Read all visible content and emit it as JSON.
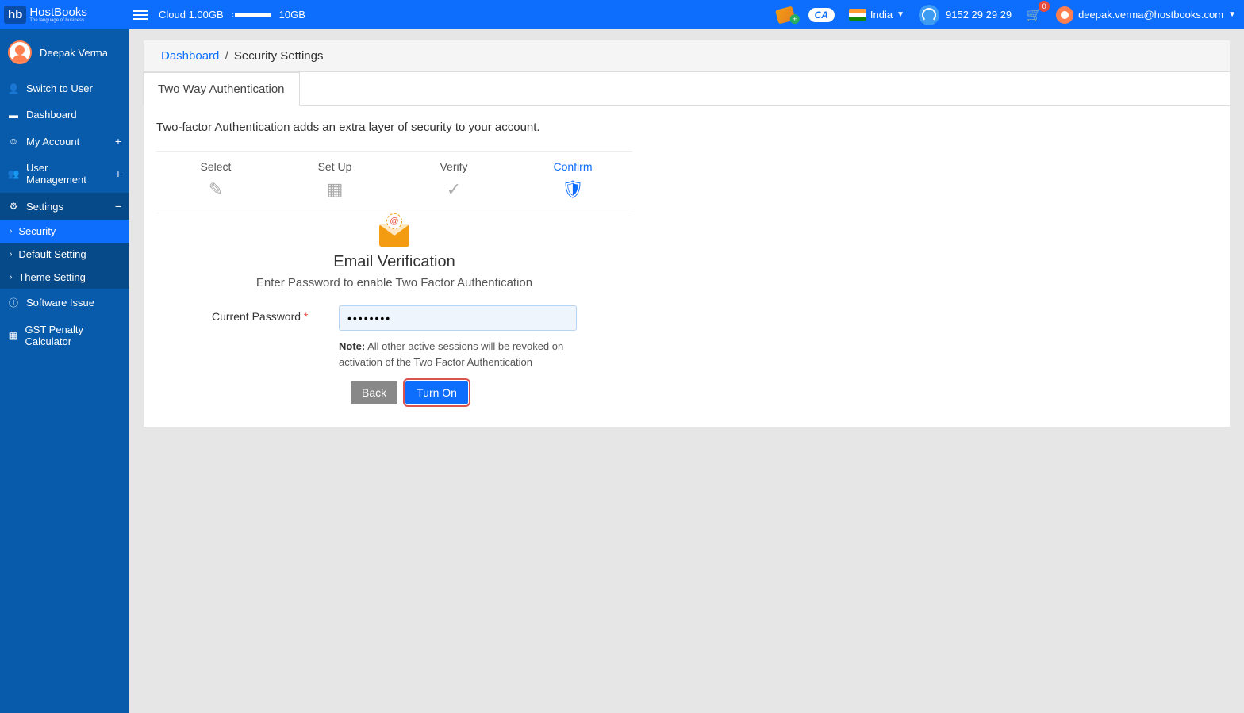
{
  "header": {
    "logo_hb": "hb",
    "logo_main": "HostBooks",
    "logo_tagline": "The language of business",
    "cloud_used": "Cloud 1.00GB",
    "cloud_total": "10GB",
    "ca_badge": "CA",
    "country": "India",
    "phone": "9152 29 29 29",
    "cart_count": "0",
    "user_email": "deepak.verma@hostbooks.com"
  },
  "sidebar": {
    "user_name": "Deepak Verma",
    "items": {
      "switch_user": "Switch to User",
      "dashboard": "Dashboard",
      "my_account": "My Account",
      "user_mgmt": "User Management",
      "settings": "Settings",
      "security": "Security",
      "default_setting": "Default Setting",
      "theme_setting": "Theme Setting",
      "software_issue": "Software Issue",
      "gst_calc": "GST Penalty Calculator"
    }
  },
  "breadcrumb": {
    "dashboard": "Dashboard",
    "sep": "/",
    "current": "Security Settings"
  },
  "tab": {
    "two_way_auth": "Two Way Authentication"
  },
  "content": {
    "description": "Two-factor Authentication adds an extra layer of security to your account.",
    "steps": {
      "select": "Select",
      "setup": "Set Up",
      "verify": "Verify",
      "confirm": "Confirm"
    },
    "form": {
      "title": "Email Verification",
      "subtitle": "Enter Password to enable Two Factor Authentication",
      "password_label": "Current Password",
      "password_value": "••••••••",
      "note_label": "Note:",
      "note_text": " All other active sessions will be revoked on activation of the Two Factor Authentication",
      "back_btn": "Back",
      "turnon_btn": "Turn On"
    }
  }
}
